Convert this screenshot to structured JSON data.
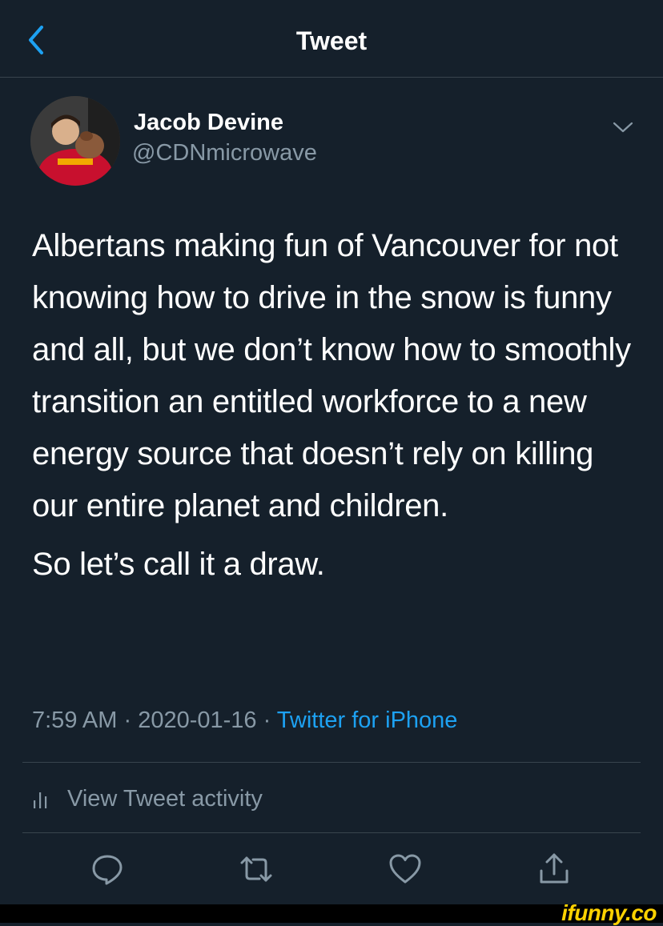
{
  "header": {
    "title": "Tweet",
    "back_icon": "chevron-left-icon"
  },
  "author": {
    "name": "Jacob Devine",
    "handle": "@CDNmicrowave"
  },
  "tweet": {
    "paragraph_1": "Albertans making fun of Vancouver for not knowing how to drive in the snow is funny and all, but we don’t know how to smoothly transition an entitled workforce to a new energy source that doesn’t rely on killing our entire planet and children.",
    "paragraph_2": "So let’s call it a draw."
  },
  "meta": {
    "time": "7:59 AM",
    "date": "2020-01-16",
    "separator": " · ",
    "source": "Twitter for iPhone"
  },
  "activity": {
    "label": "View Tweet activity",
    "icon": "bar-chart-icon"
  },
  "actions": {
    "icons": [
      "reply-icon",
      "retweet-icon",
      "like-icon",
      "share-icon"
    ]
  },
  "watermark": {
    "text": "ifunny.co",
    "color": "#ffd200"
  },
  "colors": {
    "background": "#15202b",
    "divider": "#38444d",
    "muted": "#8899a6",
    "accent": "#1da1f2"
  }
}
